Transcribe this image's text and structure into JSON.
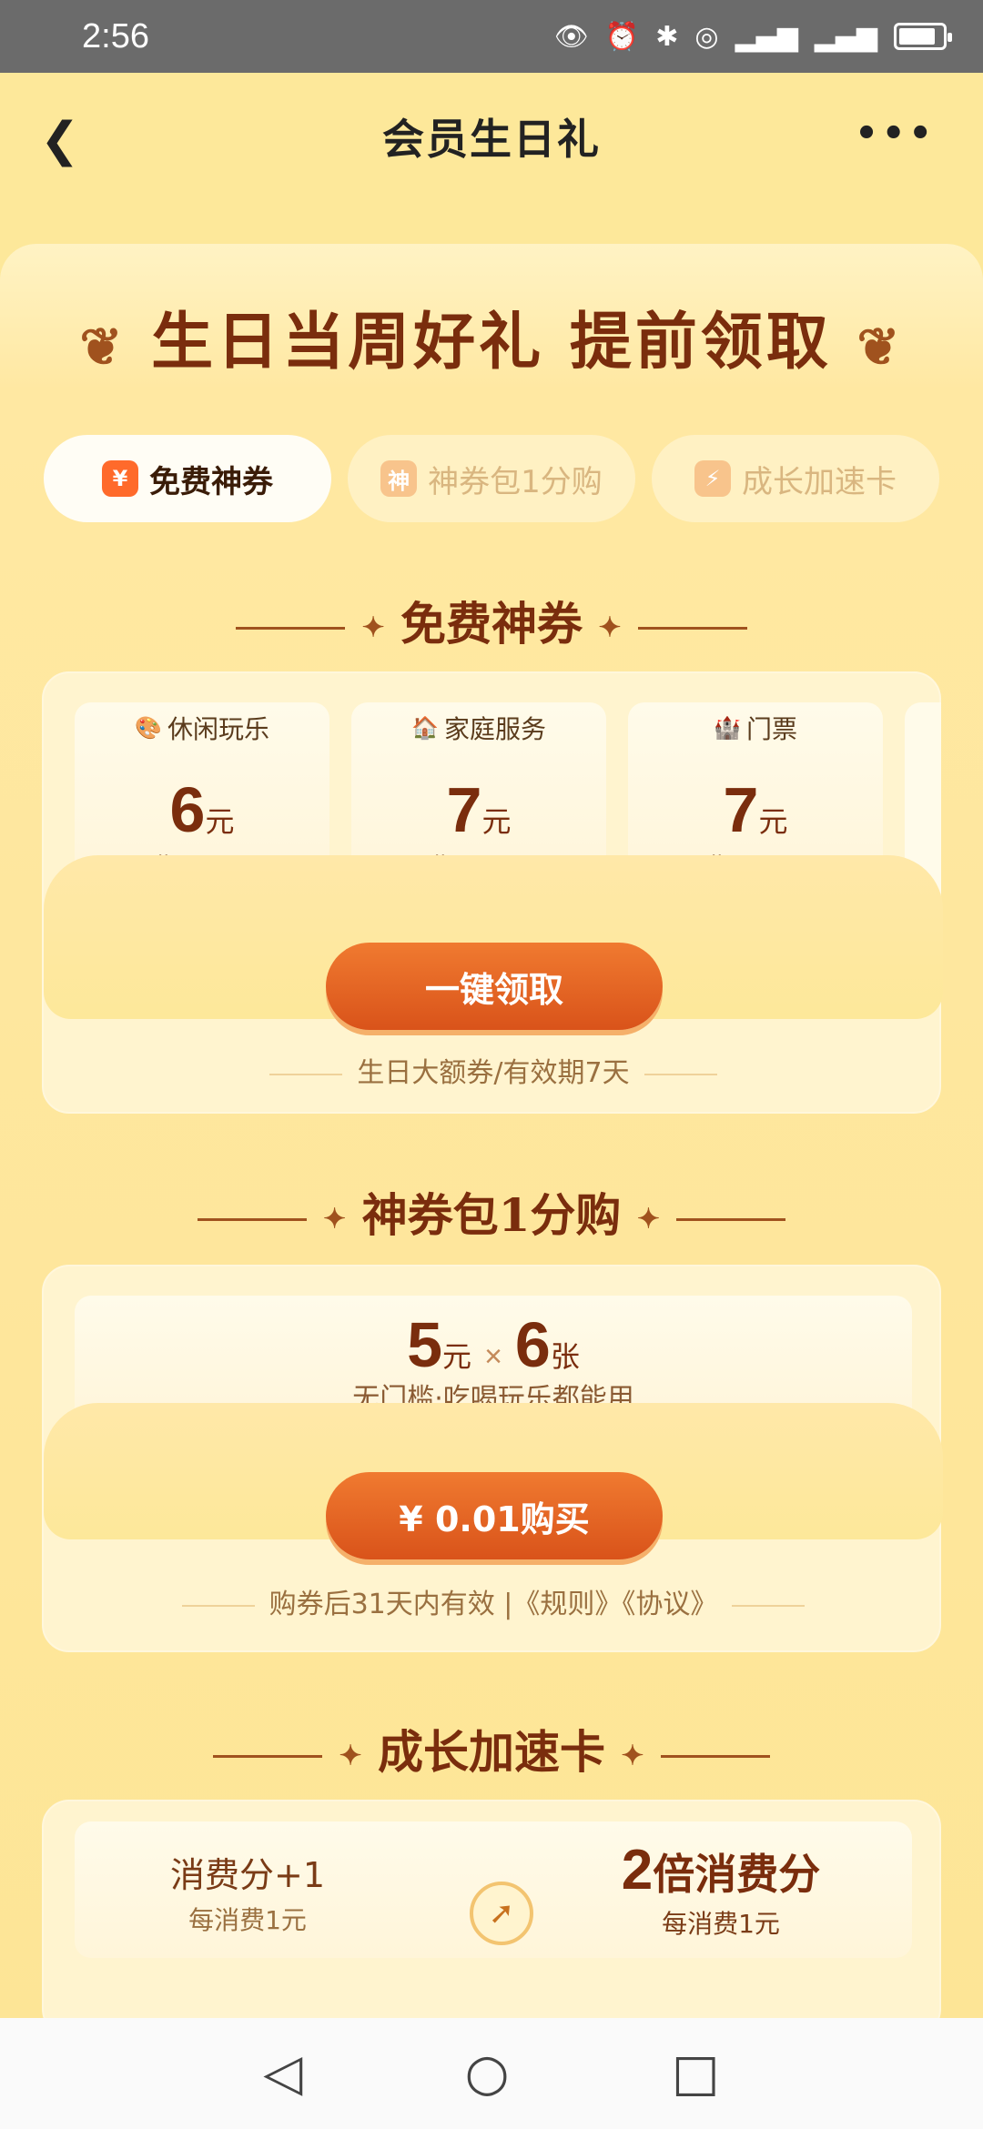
{
  "status_bar": {
    "time": "2:56",
    "icons": [
      "eye-icon",
      "alarm-icon",
      "bluetooth-icon",
      "hotspot-icon",
      "signal-icon",
      "signal-icon",
      "battery-icon"
    ]
  },
  "header": {
    "title": "会员生日礼"
  },
  "hero": {
    "title": "生日当周好礼 提前领取"
  },
  "tabs": [
    {
      "label": "免费神券",
      "icon_text": "¥",
      "active": true
    },
    {
      "label": "神券包1分购",
      "icon_text": "神",
      "active": false
    },
    {
      "label": "成长加速卡",
      "icon_text": "⚡",
      "active": false
    }
  ],
  "section_free": {
    "title": "免费神券",
    "coupons": [
      {
        "category": "休闲玩乐",
        "amount": "6",
        "unit": "元",
        "condition": "满48可用"
      },
      {
        "category": "家庭服务",
        "amount": "7",
        "unit": "元",
        "condition": "满79可用"
      },
      {
        "category": "门票",
        "amount": "7",
        "unit": "元",
        "condition": "满50可用"
      }
    ],
    "button": "一键领取",
    "note": "生日大额券/有效期7天"
  },
  "section_pack": {
    "title": "神券包1分购",
    "amount": "5",
    "amount_unit": "元",
    "times": "×",
    "count": "6",
    "count_unit": "张",
    "sub": "无门槛·吃喝玩乐都能用",
    "button": "¥ 0.01购买",
    "note": "购券后31天内有效 |《规则》《协议》"
  },
  "section_accel": {
    "title": "成长加速卡",
    "left_title": "消费分+1",
    "left_sub": "每消费1元",
    "right_big": "2",
    "right_title": "倍消费分",
    "right_sub": "每消费1元"
  },
  "colors": {
    "background": "#fde89a",
    "accent": "#e0621f",
    "title_brown": "#7a2d0d"
  }
}
